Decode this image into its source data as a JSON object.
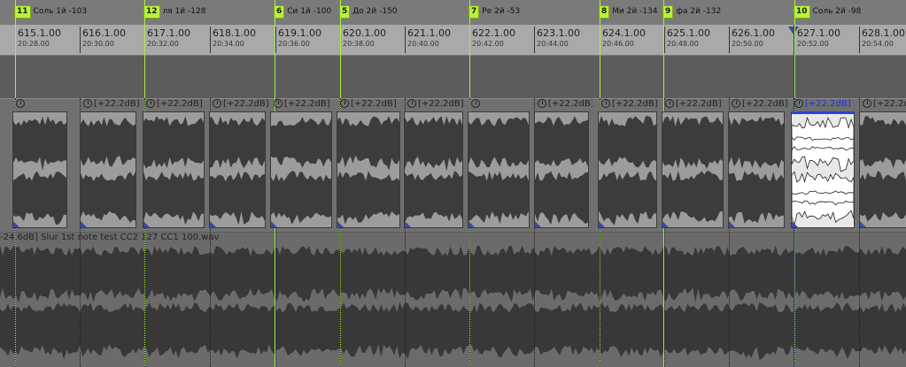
{
  "markers": [
    {
      "num": "11",
      "name": "Соль 1й -103"
    },
    {
      "num": "12",
      "name": "ля 1й -128"
    },
    {
      "num": "6",
      "name": "Си 1й -100"
    },
    {
      "num": "5",
      "name": "До 2й -150"
    },
    {
      "num": "7",
      "name": "Ре 2й -53"
    },
    {
      "num": "8",
      "name": "Ми 2й -134"
    },
    {
      "num": "9",
      "name": "фа 2й -132"
    },
    {
      "num": "10",
      "name": "Соль 2й -98"
    }
  ],
  "ruler": [
    {
      "bar": "615.1.00",
      "time": "20:28.00"
    },
    {
      "bar": "616.1.00",
      "time": "20:30.00"
    },
    {
      "bar": "617.1.00",
      "time": "20:32.00"
    },
    {
      "bar": "618.1.00",
      "time": "20:34.00"
    },
    {
      "bar": "619.1.00",
      "time": "20:36.00"
    },
    {
      "bar": "620.1.00",
      "time": "20:38.00"
    },
    {
      "bar": "621.1.00",
      "time": "20:40.00"
    },
    {
      "bar": "622.1.00",
      "time": "20:42.00"
    },
    {
      "bar": "623.1.00",
      "time": "20:44.00"
    },
    {
      "bar": "624.1.00",
      "time": "20:46.00"
    },
    {
      "bar": "625.1.00",
      "time": "20:48.00"
    },
    {
      "bar": "626.1.00",
      "time": "20:50.00"
    },
    {
      "bar": "627.1.00",
      "time": "20:52.00"
    },
    {
      "bar": "628.1.00",
      "time": "20:54.00"
    }
  ],
  "track1": {
    "clips": [
      {
        "gain": "",
        "selected": false
      },
      {
        "gain": "[+22.2dB]",
        "selected": false
      },
      {
        "gain": "[+22.2dB]",
        "selected": false
      },
      {
        "gain": "[+22.2dB]",
        "selected": false
      },
      {
        "gain": "[+22.2dB]",
        "selected": false
      },
      {
        "gain": "[+22.2dB]",
        "selected": false
      },
      {
        "gain": "[+22.2dB]",
        "selected": false
      },
      {
        "gain": "",
        "selected": false
      },
      {
        "gain": "[+22.2dB]",
        "selected": false
      },
      {
        "gain": "[+22.2dB]",
        "selected": false
      },
      {
        "gain": "[+22.2dB]",
        "selected": false
      },
      {
        "gain": "[+22.2dB]",
        "selected": false
      },
      {
        "gain": "[+22.2dB]",
        "selected": true
      },
      {
        "gain": "[+22.2dB]",
        "selected": false
      }
    ]
  },
  "track2": {
    "label": "-24.6dB] Slur 1st note test CC2 127 CC1 100.wav"
  },
  "colors": {
    "marker_accent": "#b9f23a",
    "selection_blue": "#2f3fd8",
    "waveform_dark": "#3a3a3a"
  },
  "icons": {
    "clip_fade": "fade-handle-icon",
    "cursor": "playhead-triangle-icon"
  }
}
